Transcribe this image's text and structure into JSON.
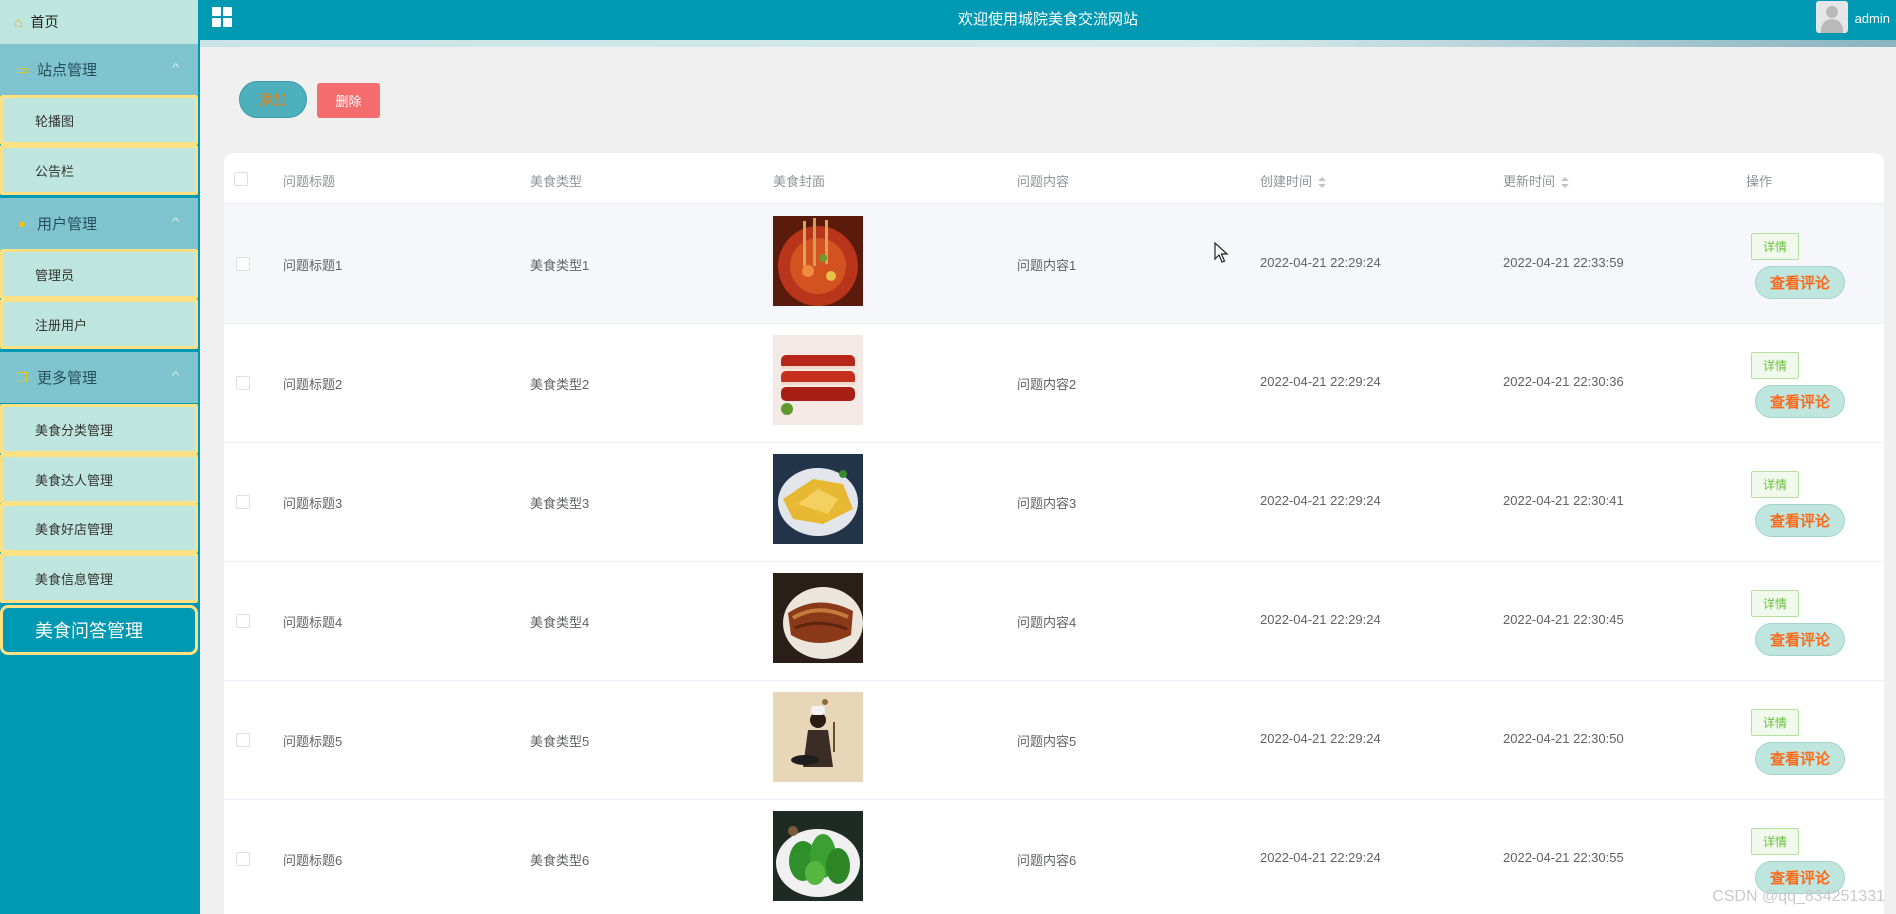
{
  "header": {
    "site_title": "欢迎使用城院美食交流网站",
    "username": "admin"
  },
  "sidebar": {
    "home": "首页",
    "groups": [
      {
        "label": "站点管理",
        "items": [
          "轮播图",
          "公告栏"
        ]
      },
      {
        "label": "用户管理",
        "items": [
          "管理员",
          "注册用户"
        ]
      },
      {
        "label": "更多管理",
        "items": [
          "美食分类管理",
          "美食达人管理",
          "美食好店管理",
          "美食信息管理"
        ]
      }
    ],
    "active": "美食问答管理"
  },
  "toolbar": {
    "add_label": "添加",
    "delete_label": "删除"
  },
  "table": {
    "columns": [
      "问题标题",
      "美食类型",
      "美食封面",
      "问题内容",
      "创建时间",
      "更新时间",
      "操作"
    ],
    "detail_label": "详情",
    "comment_label": "查看评论",
    "rows": [
      {
        "title": "问题标题1",
        "type": "美食类型1",
        "content": "问题内容1",
        "created": "2022-04-21 22:29:24",
        "updated": "2022-04-21 22:33:59",
        "image": "spicy-seafood-pot"
      },
      {
        "title": "问题标题2",
        "type": "美食类型2",
        "content": "问题内容2",
        "created": "2022-04-21 22:29:24",
        "updated": "2022-04-21 22:30:36",
        "image": "roast-pork-slices"
      },
      {
        "title": "问题标题3",
        "type": "美食类型3",
        "content": "问题内容3",
        "created": "2022-04-21 22:29:24",
        "updated": "2022-04-21 22:30:41",
        "image": "golden-chicken"
      },
      {
        "title": "问题标题4",
        "type": "美食类型4",
        "content": "问题内容4",
        "created": "2022-04-21 22:29:24",
        "updated": "2022-04-21 22:30:45",
        "image": "braised-pork-belly"
      },
      {
        "title": "问题标题5",
        "type": "美食类型5",
        "content": "问题内容5",
        "created": "2022-04-21 22:29:24",
        "updated": "2022-04-21 22:30:50",
        "image": "chef-with-wok"
      },
      {
        "title": "问题标题6",
        "type": "美食类型6",
        "content": "问题内容6",
        "created": "2022-04-21 22:29:24",
        "updated": "2022-04-21 22:30:55",
        "image": "green-vegetables"
      }
    ]
  },
  "watermark": "CSDN @qq_834251331",
  "colors": {
    "primary": "#0099b4",
    "sidebar_item": "#bfe6de",
    "sidebar_border": "#ffe082",
    "danger": "#f56c6c",
    "comment_text": "#ff6a1a"
  }
}
